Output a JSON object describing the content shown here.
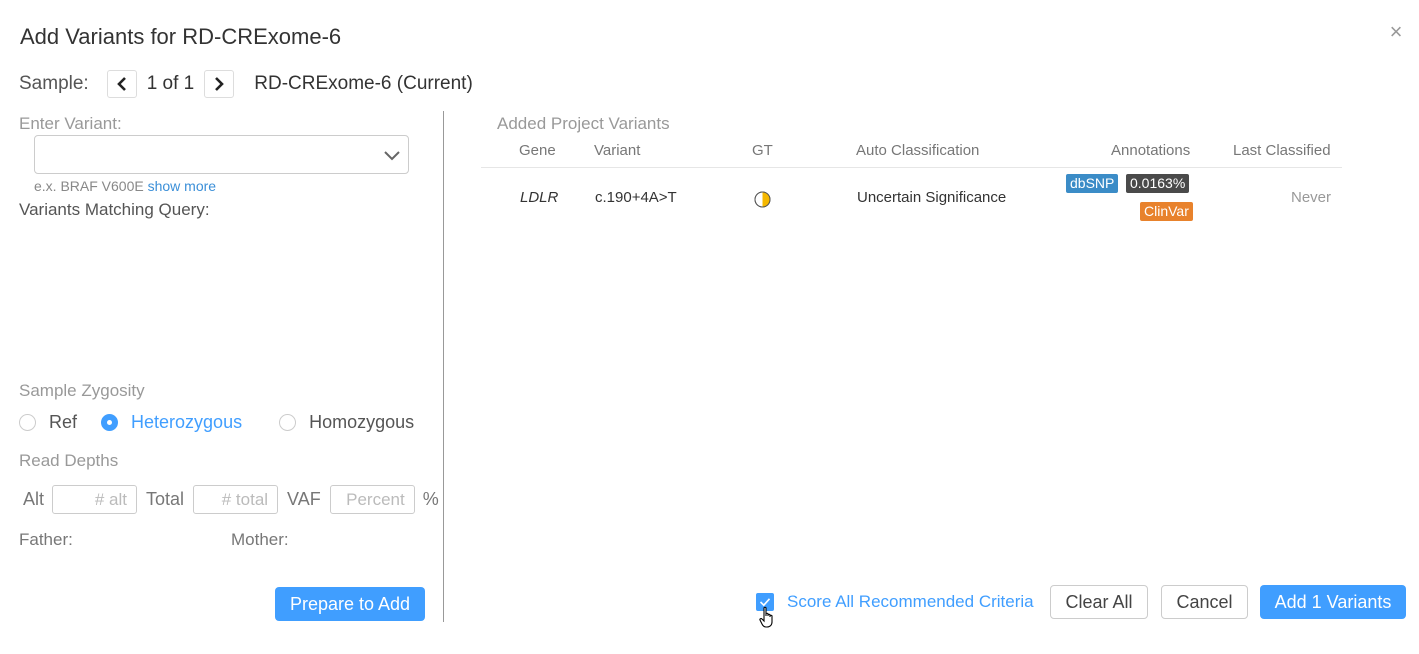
{
  "dialog": {
    "title": "Add Variants for RD-CRExome-6",
    "close_glyph": "×"
  },
  "sample": {
    "label": "Sample:",
    "count": "1 of 1",
    "name": "RD-CRExome-6 (Current)"
  },
  "left": {
    "enter_variant_label": "Enter Variant:",
    "variant_input_value": "",
    "hint_prefix": "e.x. BRAF V600E",
    "hint_link": "show more",
    "matching_label": "Variants Matching Query:",
    "zygosity_label": "Sample Zygosity",
    "zygosity_options": [
      {
        "label": "Ref",
        "selected": false
      },
      {
        "label": "Heterozygous",
        "selected": true
      },
      {
        "label": "Homozygous",
        "selected": false
      }
    ],
    "read_depths_label": "Read Depths",
    "alt_label": "Alt",
    "alt_placeholder": "# alt",
    "total_label": "Total",
    "total_placeholder": "# total",
    "vaf_label": "VAF",
    "vaf_placeholder": "Percent",
    "percent_sign": "%",
    "father_label": "Father:",
    "mother_label": "Mother:",
    "prepare_button": "Prepare to Add"
  },
  "right": {
    "title": "Added Project Variants",
    "columns": [
      "Gene",
      "Variant",
      "GT",
      "Auto Classification",
      "Annotations",
      "Last Classified"
    ],
    "rows": [
      {
        "gene": "LDLR",
        "variant": "c.190+4A>T",
        "gt": "heterozygous-half-filled-circle-icon",
        "auto_classification": "Uncertain Significance",
        "annotations": {
          "dbsnp": "dbSNP",
          "frequency": "0.0163%",
          "clinvar": "ClinVar"
        },
        "last_classified": "Never"
      }
    ]
  },
  "footer": {
    "score_all_label": "Score All Recommended Criteria",
    "score_all_checked": true,
    "clear_all": "Clear All",
    "cancel": "Cancel",
    "add_button": "Add 1 Variants"
  },
  "colors": {
    "primary": "#409eff",
    "dbsnp_badge": "#3b8cc7",
    "freq_badge": "#4a4a4a",
    "clinvar_badge": "#e8822c",
    "gt_fill": "#f5b800"
  }
}
